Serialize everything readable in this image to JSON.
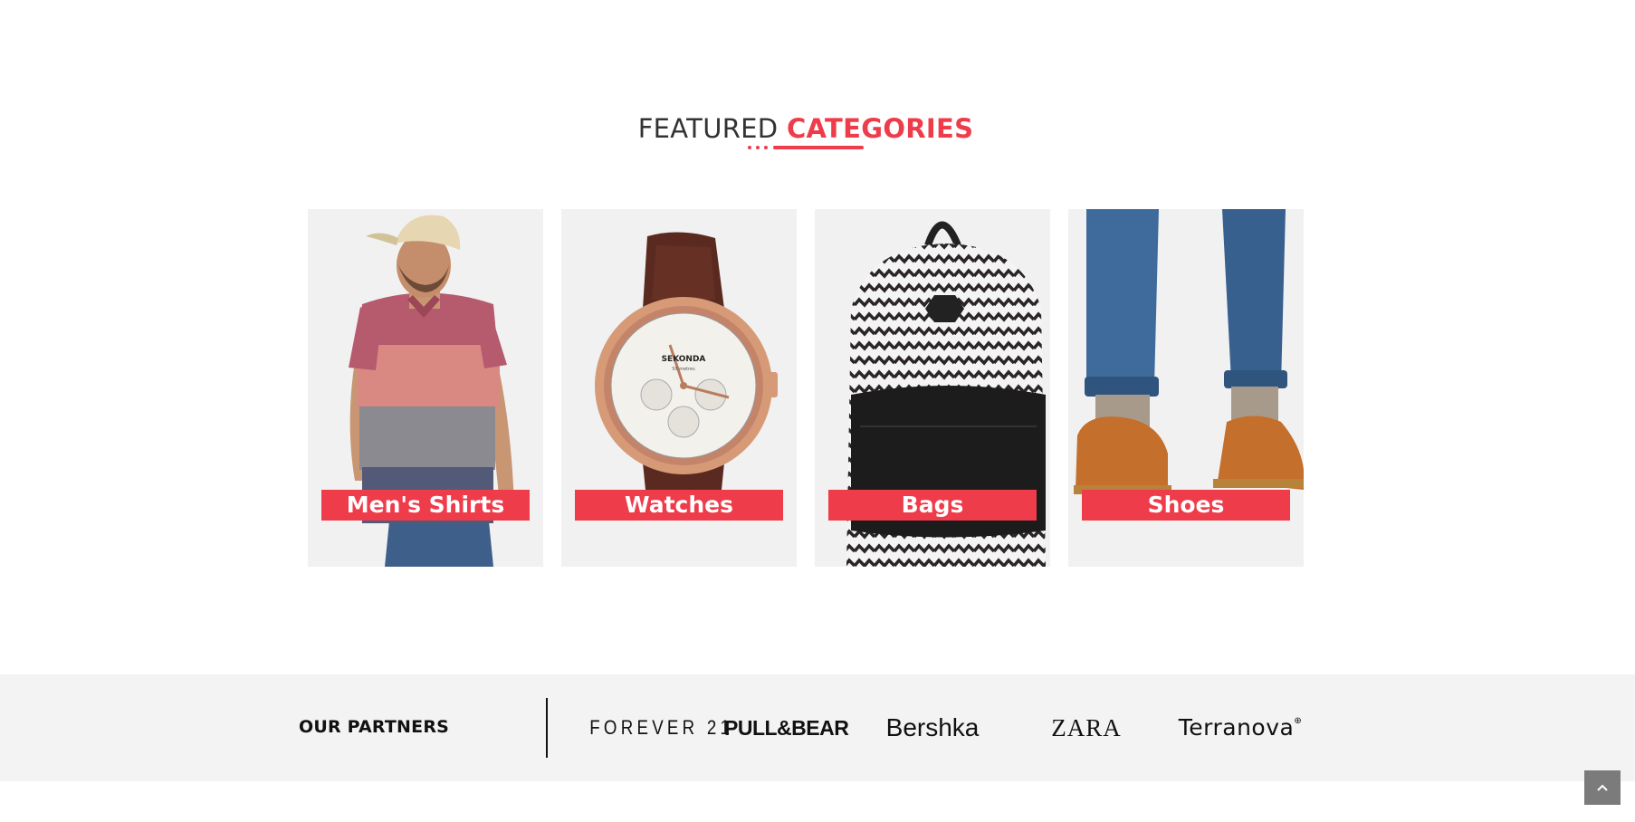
{
  "section": {
    "title_plain": "FEATURED",
    "title_accent": "CATEGORIES"
  },
  "categories": [
    {
      "label": "Men's Shirts",
      "image": "mens-shirt-photo"
    },
    {
      "label": "Watches",
      "image": "watch-photo"
    },
    {
      "label": "Bags",
      "image": "backpack-photo"
    },
    {
      "label": "Shoes",
      "image": "shoes-photo"
    }
  ],
  "watch_face": {
    "brand": "SEKONDA",
    "subtitle": "50 metres"
  },
  "partners": {
    "title": "OUR PARTNERS",
    "brands": [
      "FOREVER 21",
      "PULL&BEAR",
      "Bershka",
      "ZARA",
      "Terranova"
    ]
  },
  "back_to_top": {
    "icon": "chevron-up-icon"
  },
  "colors": {
    "accent": "#ee3c4a",
    "text_dark": "#333333",
    "partners_bg": "#f3f3f3",
    "back_to_top_bg": "#7b7b7b"
  }
}
